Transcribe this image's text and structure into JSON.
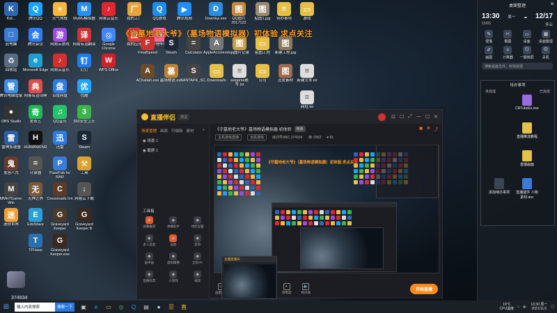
{
  "banner": "《守墓地老大爷》（墓场物语模拟器）初体验 求点关注",
  "desktop_icons": [
    {
      "label": "Kid...",
      "color": "#2f66b3",
      "glyph": "K",
      "col": 0,
      "row": 0
    },
    {
      "label": "腾讯QQ",
      "color": "#1aa3ff",
      "glyph": "Q",
      "col": 1,
      "row": 0
    },
    {
      "label": "天气预报",
      "color": "#f6b73c",
      "glyph": "☀",
      "col": 2,
      "row": 0
    },
    {
      "label": "MuMu模拟器",
      "color": "#2a8df0",
      "glyph": "M",
      "col": 3,
      "row": 0
    },
    {
      "label": "网易云音乐",
      "color": "#e0262f",
      "glyph": "♪",
      "col": 4,
      "row": 0
    },
    {
      "label": "我的工厂",
      "color": "#e8a33a",
      "glyph": "厂",
      "col": 5,
      "row": 0
    },
    {
      "label": "QQ游戏",
      "color": "#1d8cf0",
      "glyph": "Q",
      "col": 6,
      "row": 0
    },
    {
      "label": "腾讯视频",
      "color": "#1f8cff",
      "glyph": "▶",
      "col": 7,
      "row": 0
    },
    {
      "label": "此电脑",
      "color": "#3a7bd5",
      "glyph": "□",
      "col": 0,
      "row": 1
    },
    {
      "label": "腾讯会议",
      "color": "#2d7cf6",
      "glyph": "会",
      "col": 1,
      "row": 1
    },
    {
      "label": "网易云游戏",
      "color": "#9a4be0",
      "glyph": "游",
      "col": 2,
      "row": 1
    },
    {
      "label": "网易有道翻译",
      "color": "#cc3333",
      "glyph": "译",
      "col": 3,
      "row": 1
    },
    {
      "label": "Google Chrome",
      "color": "#4285f4",
      "glyph": "◎",
      "col": 4,
      "row": 1
    },
    {
      "label": "我的应用",
      "color": "#e23b3b",
      "glyph": "应",
      "col": 5,
      "row": 1
    },
    {
      "label": "哔哩哔哩",
      "color": "#ff6699",
      "glyph": "B",
      "col": 6,
      "row": 1
    },
    {
      "label": "回收站",
      "color": "#5a6b80",
      "glyph": "♻",
      "col": 0,
      "row": 2
    },
    {
      "label": "Microsoft Edge",
      "color": "#1f9fd0",
      "glyph": "e",
      "col": 1,
      "row": 2
    },
    {
      "label": "网易云音乐",
      "color": "#d42e2e",
      "glyph": "♪",
      "col": 2,
      "row": 2
    },
    {
      "label": "钉钉",
      "color": "#1e7cf0",
      "glyph": "钉",
      "col": 3,
      "row": 2
    },
    {
      "label": "WPS Office",
      "color": "#d0202a",
      "glyph": "W",
      "col": 4,
      "row": 2
    },
    {
      "label": "腾讯电脑管家",
      "color": "#3a8ee6",
      "glyph": "管",
      "col": 0,
      "row": 3
    },
    {
      "label": "网易有道词典",
      "color": "#e04b4b",
      "glyph": "典",
      "col": 1,
      "row": 3
    },
    {
      "label": "百度网盘",
      "color": "#2b7de9",
      "glyph": "盘",
      "col": 2,
      "row": 3
    },
    {
      "label": "优酷",
      "color": "#1ea6ff",
      "glyph": "优",
      "col": 3,
      "row": 3
    },
    {
      "label": "OBS Studio",
      "color": "#333",
      "glyph": "●",
      "col": 0,
      "row": 4
    },
    {
      "label": "爱奇艺",
      "color": "#1db954",
      "glyph": "奇",
      "col": 1,
      "row": 4
    },
    {
      "label": "QQ音乐",
      "color": "#27c26c",
      "glyph": "♫",
      "col": 2,
      "row": 4
    },
    {
      "label": "360安全卫士",
      "color": "#3ab54a",
      "glyph": "3",
      "col": 3,
      "row": 4
    },
    {
      "label": "雷神加速器",
      "color": "#2a5fa8",
      "glyph": "雷",
      "col": 0,
      "row": 5
    },
    {
      "label": "HUMANKIND",
      "color": "#111",
      "glyph": "H",
      "col": 1,
      "row": 5
    },
    {
      "label": "迅雷",
      "color": "#2b7be0",
      "glyph": "迅",
      "col": 2,
      "row": 5
    },
    {
      "label": "Steam",
      "color": "#1b2838",
      "glyph": "S",
      "col": 3,
      "row": 5
    },
    {
      "label": "鬼谷八荒",
      "color": "#6a3b2b",
      "glyph": "鬼",
      "col": 0,
      "row": 6
    },
    {
      "label": "计算器",
      "color": "#555",
      "glyph": "=",
      "col": 1,
      "row": 6
    },
    {
      "label": "PassFab for RAR",
      "color": "#3a7ad8",
      "glyph": "P",
      "col": 2,
      "row": 6
    },
    {
      "label": "工具",
      "color": "#d9a330",
      "glyph": "⚒",
      "col": 3,
      "row": 6
    },
    {
      "label": "MMH7Game-Win",
      "color": "#444",
      "glyph": "M",
      "col": 0,
      "row": 7
    },
    {
      "label": "无神之界",
      "color": "#7a5a3a",
      "glyph": "无",
      "col": 1,
      "row": 7
    },
    {
      "label": "Crossroads Inn",
      "color": "#5b3a2a",
      "glyph": "C",
      "col": 2,
      "row": 7
    },
    {
      "label": "网易云下载",
      "color": "#555",
      "glyph": "↓",
      "col": 3,
      "row": 7
    },
    {
      "label": "迷你世界",
      "color": "#f0a030",
      "glyph": "迷",
      "col": 0,
      "row": 8
    },
    {
      "label": "EdoWave",
      "color": "#2a9fd8",
      "glyph": "E",
      "col": 1,
      "row": 8
    },
    {
      "label": "Graveyard Keeper",
      "color": "#4a3a2a",
      "glyph": "G",
      "col": 2,
      "row": 8
    },
    {
      "label": "Graveyard Keeper B",
      "color": "#3a2a20",
      "glyph": "G",
      "col": 3,
      "row": 8
    },
    {
      "label": "TPHase",
      "color": "#2a6fb0",
      "glyph": "T",
      "col": 1,
      "row": 9
    },
    {
      "label": "Graveyard Keeper.exe",
      "color": "#3a2a20",
      "glyph": "G",
      "col": 2,
      "row": 9
    }
  ],
  "desktop_icons_mid": [
    {
      "label": "Downkyi.exe",
      "color": "#2a8de0",
      "glyph": "D"
    },
    {
      "label": "QQ图片2017122",
      "color": "#c08a40",
      "glyph": "图"
    },
    {
      "label": "贴图1.jpg",
      "color": "#9a8a70",
      "glyph": "图"
    },
    {
      "label": "待办事项",
      "color": "#e6c14a",
      "glyph": "≡"
    },
    {
      "label": "游戏",
      "color": "#e6c14a",
      "glyph": "▭"
    },
    {
      "label": "FinalSpeed",
      "color": "#d03030",
      "glyph": "F"
    },
    {
      "label": "Steam",
      "color": "#1b2838",
      "glyph": "S"
    },
    {
      "label": "Calculator",
      "color": "#444",
      "glyph": "="
    },
    {
      "label": "AppleAccelerator",
      "color": "#777",
      "glyph": "A"
    },
    {
      "label": "qq图片记录",
      "color": "#c9a04a",
      "glyph": "图"
    },
    {
      "label": "贴图工程",
      "color": "#e6c14a",
      "glyph": "▭"
    },
    {
      "label": "新建工程.jpg",
      "color": "#8a7a60",
      "glyph": "图"
    },
    {
      "label": "AChallah.exe",
      "color": "#6a4a2a",
      "glyph": "A"
    },
    {
      "label": "墓场物语.exe",
      "color": "#c08030",
      "glyph": "墓"
    },
    {
      "label": "SANTAPK_SC.exe",
      "color": "#444",
      "glyph": "S"
    },
    {
      "label": "Downloads",
      "color": "#e6c14a",
      "glyph": "▭"
    },
    {
      "label": "wegame账号.txt",
      "color": "#ddd",
      "glyph": "≡"
    },
    {
      "label": "公司",
      "color": "#e6c14a",
      "glyph": "▭"
    },
    {
      "label": "恋爱素材",
      "color": "#a06a50",
      "glyph": "图"
    },
    {
      "label": "新建文本.txt",
      "color": "#ddd",
      "glyph": "≡"
    },
    {
      "label": "网址.txt",
      "color": "#ddd",
      "glyph": "≡"
    }
  ],
  "right_panel": {
    "header": "桌面整理",
    "close": "✕",
    "time": "13:30",
    "day": "周一",
    "date": "12/17",
    "date2": "11/01",
    "weather_desc": "多云",
    "weather_icon": "☁",
    "tools": [
      {
        "label": "便笺",
        "glyph": "✎"
      },
      {
        "label": "截图",
        "glyph": "✂"
      },
      {
        "label": "桌面",
        "glyph": "▭"
      },
      {
        "label": "桌面整理",
        "glyph": "▦"
      },
      {
        "label": "画图",
        "glyph": "✐"
      },
      {
        "label": "计算器",
        "glyph": "="
      },
      {
        "label": "一键锁屏",
        "glyph": "⏻"
      },
      {
        "label": "关机",
        "glyph": "⏼"
      }
    ],
    "search_placeholder": "搜索桌面文件、秒找资源",
    "box_title": "待办事项",
    "box_left": "未完成",
    "box_right": "已完成",
    "files": [
      {
        "label": "CRTubeEx.exe",
        "color": "#9a6ae0"
      },
      {
        "label": "直播推流教程",
        "color": "#e6c14a"
      },
      {
        "label": "直播画面",
        "color": "#e6c14a"
      },
      {
        "label": "添加待办事项",
        "color": "#3a4656"
      },
      {
        "label": "直播插件 人物素材.doc",
        "color": "#3a7bd5"
      }
    ]
  },
  "app": {
    "logo": "直播伴侣",
    "version": "测试",
    "controls": [
      "⊡",
      "☐",
      "⤢",
      "—",
      "☐",
      "✕"
    ],
    "tabs": [
      {
        "label": "场景管理",
        "active": true
      },
      {
        "label": "画面",
        "active": false
      },
      {
        "label": "可编辑",
        "active": false
      },
      {
        "label": "素材",
        "active": false
      }
    ],
    "scenes": [
      "场景 1",
      "截屏 1"
    ],
    "toolbox_title": "工具箱",
    "tools": [
      "屏幕推荐",
      "弹幕助手",
      "场控设置",
      "多人连麦",
      "美颜",
      "音效",
      "画中画",
      "虚拟摄像",
      "全民PK",
      "直播投票",
      "小游戏",
      "福袋"
    ],
    "stream_title": "《守墓地老大爷》墓场物语模拟器 初体验",
    "edit": "修改",
    "info_cat": "主机游戏直播",
    "info_tag": "全民游戏",
    "info_room": "房间号ABC 374934",
    "info_online": "👁 2963",
    "info_likes": "♥ 81",
    "preview_banner": "《守墓地老大爷》（墓场物语模拟器）初体验 求点关注",
    "bottom": [
      "画面设置",
      "音频设置",
      "录制设置",
      "清晰度",
      "扬声器"
    ],
    "live_btn": "开始直播"
  },
  "mini_window_title": "主播直播间",
  "watermark_num": "374934",
  "taskbar": {
    "start": "⊞",
    "search": "输入内容搜索",
    "search_btn": "搜索一下",
    "temp": "19°C",
    "weather": "CPU温度",
    "time": "13:30 周一",
    "date": "2021/11/1"
  }
}
